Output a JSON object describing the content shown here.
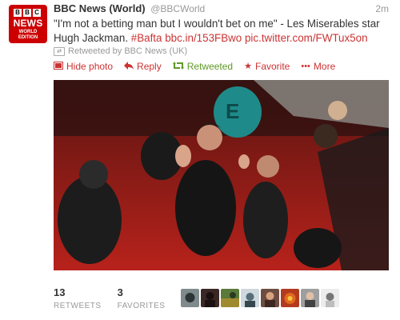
{
  "avatar": {
    "letters": [
      "B",
      "B",
      "C"
    ],
    "news": "NEWS",
    "edition_line1": "WORLD",
    "edition_line2": "EDITION"
  },
  "tweet": {
    "fullname": "BBC News (World)",
    "screen_name": "@BBCWorld",
    "time": "2m",
    "text_plain": "\"I'm not a betting man but I wouldn't bet on me\" - Les Miserables star Hugh Jackman. ",
    "hashtag": "#Bafta",
    "link": "bbc.in/153FBwo",
    "pic_link": "pic.twitter.com/FWTux5on",
    "retweeted_by": "Retweeted by BBC News (UK)"
  },
  "actions": {
    "hide_photo": "Hide photo",
    "reply": "Reply",
    "retweeted": "Retweeted",
    "favorite": "Favorite",
    "more": "More"
  },
  "stats": {
    "retweets_count": "13",
    "retweets_label": "RETWEETS",
    "favorites_count": "3",
    "favorites_label": "FAVORITES"
  },
  "colors": {
    "link": "#cc3333",
    "retweeted": "#609928",
    "bbc_red": "#cc0000"
  }
}
